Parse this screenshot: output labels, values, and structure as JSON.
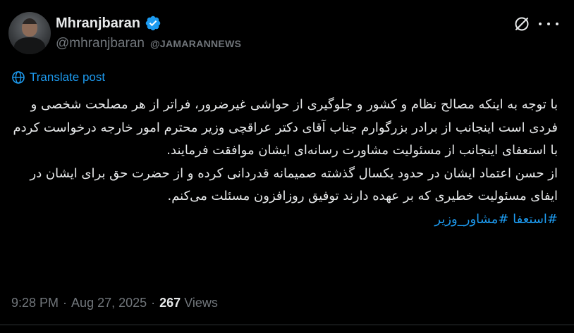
{
  "author": {
    "display_name": "Mhranjbaran",
    "handle": "@mhranjbaran",
    "affiliation": "@JAMARANNEWS",
    "verified": true,
    "verified_color": "#1d9bf0",
    "avatar_icon": "user-avatar"
  },
  "header": {
    "grok_icon": "grok-icon",
    "more_icon": "more-icon"
  },
  "translate": {
    "label": "Translate post",
    "icon": "translate-globe-icon",
    "color": "#1d9bf0"
  },
  "post": {
    "paragraph_1": "با توجه به اینکه مصالح نظام و کشور و جلوگیری از حواشی غیرضرور، فراتر از هر مصلحت شخصی و فردی است اینجانب از برادر بزرگوارم جناب آقای دکتر عراقچی وزیر محترم امور خارجه درخواست کردم با استعفای اینجانب از مسئولیت مشاورت رسانه‌ای ایشان موافقت فرمایند.",
    "paragraph_2": "از حسن اعتماد ایشان در حدود یکسال گذشته صمیمانه قدردانی کرده و از حضرت حق برای ایشان در ایفای مسئولیت خطیری که بر عهده دارند توفیق روزافزون مسئلت می‌کنم.",
    "hashtags": "#استعفا #مشاور_وزیر"
  },
  "meta": {
    "time": "9:28 PM",
    "date": "Aug 27, 2025",
    "separator": "·",
    "views_count": "267",
    "views_label": "Views"
  },
  "colors": {
    "background": "#000000",
    "text": "#e7e9ea",
    "secondary": "#71767b",
    "accent": "#1d9bf0"
  }
}
